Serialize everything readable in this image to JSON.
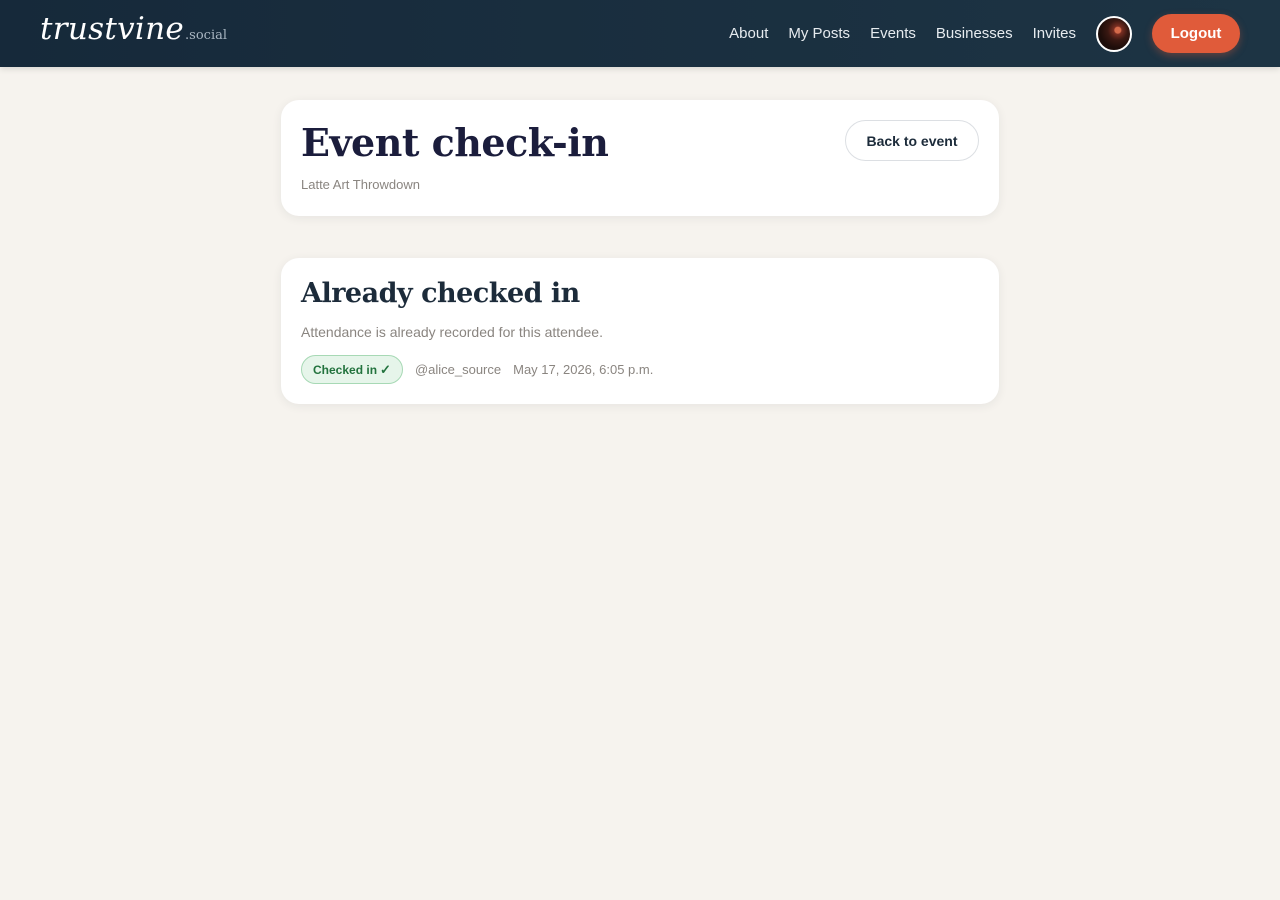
{
  "header": {
    "brand": {
      "name": "trustvine",
      "suffix": ".social"
    },
    "nav": [
      {
        "label": "About"
      },
      {
        "label": "My Posts"
      },
      {
        "label": "Events"
      },
      {
        "label": "Businesses"
      },
      {
        "label": "Invites"
      }
    ],
    "logout_label": "Logout"
  },
  "page": {
    "title": "Event check-in",
    "event_name": "Latte Art Throwdown",
    "back_label": "Back to event"
  },
  "status": {
    "title": "Already checked in",
    "description": "Attendance is already recorded for this attendee.",
    "badge_label": "Checked in",
    "badge_icon": "check-icon",
    "username": "@alice_source",
    "timestamp": "May 17, 2026, 6:05 p.m."
  },
  "colors": {
    "header_bg": "#16293a",
    "page_bg": "#f6f3ee",
    "accent": "#e05b3a",
    "success_bg": "#e6f5ea",
    "success_text": "#23733e"
  }
}
